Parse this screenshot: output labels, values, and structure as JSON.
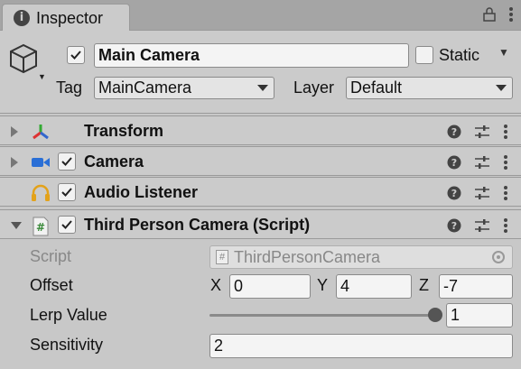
{
  "window": {
    "tab_title": "Inspector",
    "tab_icon": "i"
  },
  "header": {
    "active": true,
    "name": "Main Camera",
    "static_label": "Static",
    "static_checked": false,
    "tag_label": "Tag",
    "tag_value": "MainCamera",
    "layer_label": "Layer",
    "layer_value": "Default"
  },
  "components": [
    {
      "title": "Transform",
      "icon": "transform-icon",
      "expanded": false,
      "has_checkbox": false
    },
    {
      "title": "Camera",
      "icon": "camera-icon",
      "expanded": false,
      "has_checkbox": true,
      "enabled": true
    },
    {
      "title": "Audio Listener",
      "icon": "headphones-icon",
      "expanded": false,
      "has_checkbox": true,
      "enabled": true
    },
    {
      "title": "Third Person Camera (Script)",
      "icon": "script-hash-icon",
      "expanded": true,
      "has_checkbox": true,
      "enabled": true
    }
  ],
  "script_props": {
    "script_label": "Script",
    "script_value": "ThirdPersonCamera",
    "offset_label": "Offset",
    "offset": {
      "x_label": "X",
      "x": "0",
      "y_label": "Y",
      "y": "4",
      "z_label": "Z",
      "z": "-7"
    },
    "lerp_label": "Lerp Value",
    "lerp_value": "1",
    "lerp_fraction": 1.0,
    "sensitivity_label": "Sensitivity",
    "sensitivity_value": "2"
  },
  "colors": {
    "panel_bg": "#cbcbcb",
    "tab_strip": "#a5a5a5",
    "camera_blue": "#2a6fd6",
    "audio_gold": "#e3a21a",
    "transform_red": "#d33",
    "transform_green": "#3a3",
    "transform_blue": "#36c"
  }
}
